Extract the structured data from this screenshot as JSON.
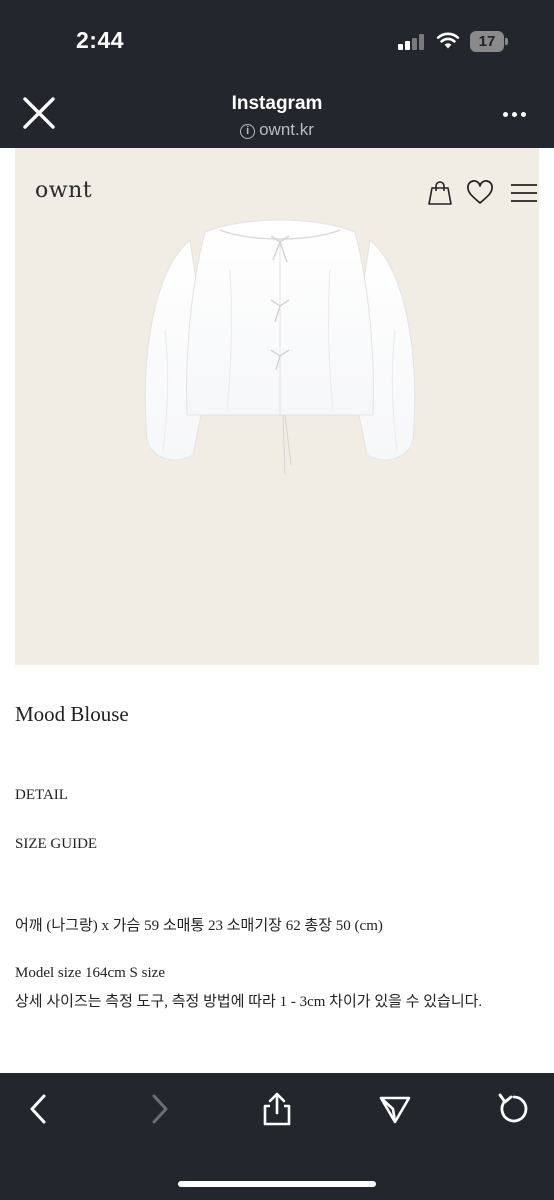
{
  "status_bar": {
    "time": "2:44",
    "battery_level": "17"
  },
  "browser_header": {
    "title": "Instagram",
    "url": "ownt.kr",
    "info_glyph": "i"
  },
  "site": {
    "logo": "ownt",
    "icons": [
      "shopping-bag-icon",
      "heart-icon",
      "hamburger-menu-icon"
    ]
  },
  "product": {
    "name": "Mood Blouse",
    "detail_link": "DETAIL",
    "size_guide_link": "SIZE GUIDE",
    "measurements": "어깨 (나그랑) x 가슴 59 소매통 23 소매기장 62 총장 50 (cm)",
    "model_size": "Model size 164cm S size",
    "size_note": "상세 사이즈는 측정 도구, 측정 방법에 따라 1 - 3cm 차이가 있을 수 있습니다."
  },
  "toolbar": {
    "icons": [
      "back-arrow-icon",
      "forward-arrow-icon",
      "share-icon",
      "send-icon",
      "reload-icon"
    ]
  },
  "colors": {
    "chrome_bg": "#23262c",
    "hero_bg": "#f1ede4",
    "text": "#222222"
  }
}
